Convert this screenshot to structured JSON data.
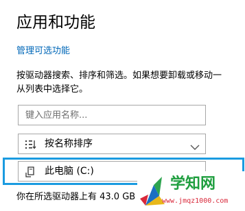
{
  "page": {
    "title": "应用和功能",
    "optional_features_link": "管理可选功能",
    "description": "按驱动器搜索、排序和筛选。如果想要卸载或移动一个应用，请从列表中选择它。",
    "description_line1": "按驱动器搜索、排序和筛选。如果想要卸载或移动一",
    "description_line2": "从列表中选择它。"
  },
  "search": {
    "placeholder": "键入应用名称..."
  },
  "sort": {
    "label": "按名称排序",
    "icon": "sort-list-icon"
  },
  "drive": {
    "label": "此电脑 (C:)",
    "icon": "drive-filter-icon",
    "highlight_color": "#1a9be0"
  },
  "status": {
    "text": "你在所选驱动器上有 43.0 GB"
  },
  "watermark": {
    "brand": "学知网",
    "site": "www.jmqz1000.com"
  },
  "colors": {
    "link": "#0067b8",
    "highlight": "#1a9be0",
    "watermark_green": "#1e9e3e",
    "watermark_red": "#d9283a"
  }
}
